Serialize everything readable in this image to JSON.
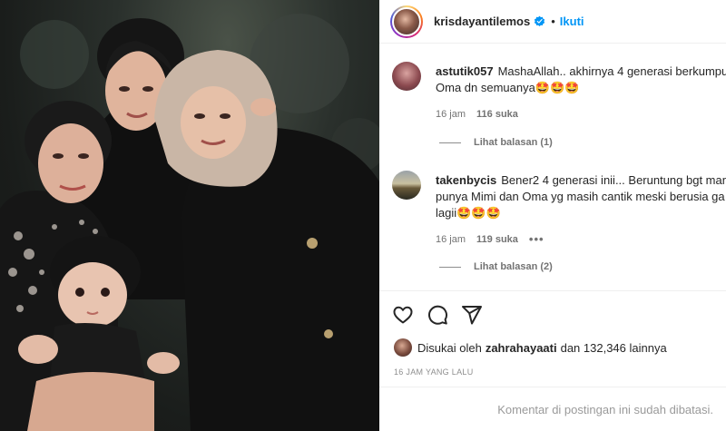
{
  "header": {
    "username": "krisdayantilemos",
    "separator": "•",
    "follow_label": "Ikuti"
  },
  "comments": [
    {
      "username": "astutik057",
      "text_line1": "MashaAllah.. akhirnya 4 generasi berkumpu",
      "text_line2": "Oma dn semuanya🤩🤩🤩",
      "time": "16 jam",
      "likes": "116 suka",
      "replies_label": "Lihat balasan (1)"
    },
    {
      "username": "takenbycis",
      "text_line1": "Bener2 4 generasi inii... Beruntung bgt man",
      "text_line2": "punya Mimi dan Oma yg masih cantik meski berusia ga",
      "text_line3": "lagii🤩🤩🤩",
      "time": "16 jam",
      "likes": "119 suka",
      "more_label": "•••",
      "replies_label": "Lihat balasan (2)"
    }
  ],
  "actions": {
    "like_icon": "heart-icon",
    "comment_icon": "comment-icon",
    "share_icon": "paper-plane-icon"
  },
  "likes_summary": {
    "prefix": "Disukai oleh",
    "user": "zahrahayaati",
    "suffix": "dan 132,346 lainnya"
  },
  "timestamp": "16 JAM YANG LALU",
  "footer": {
    "comments_limited": "Komentar di postingan ini sudah dibatasi."
  },
  "colors": {
    "accent": "#0095f6",
    "text": "#262626",
    "muted": "#737373",
    "divider": "#efefef"
  }
}
